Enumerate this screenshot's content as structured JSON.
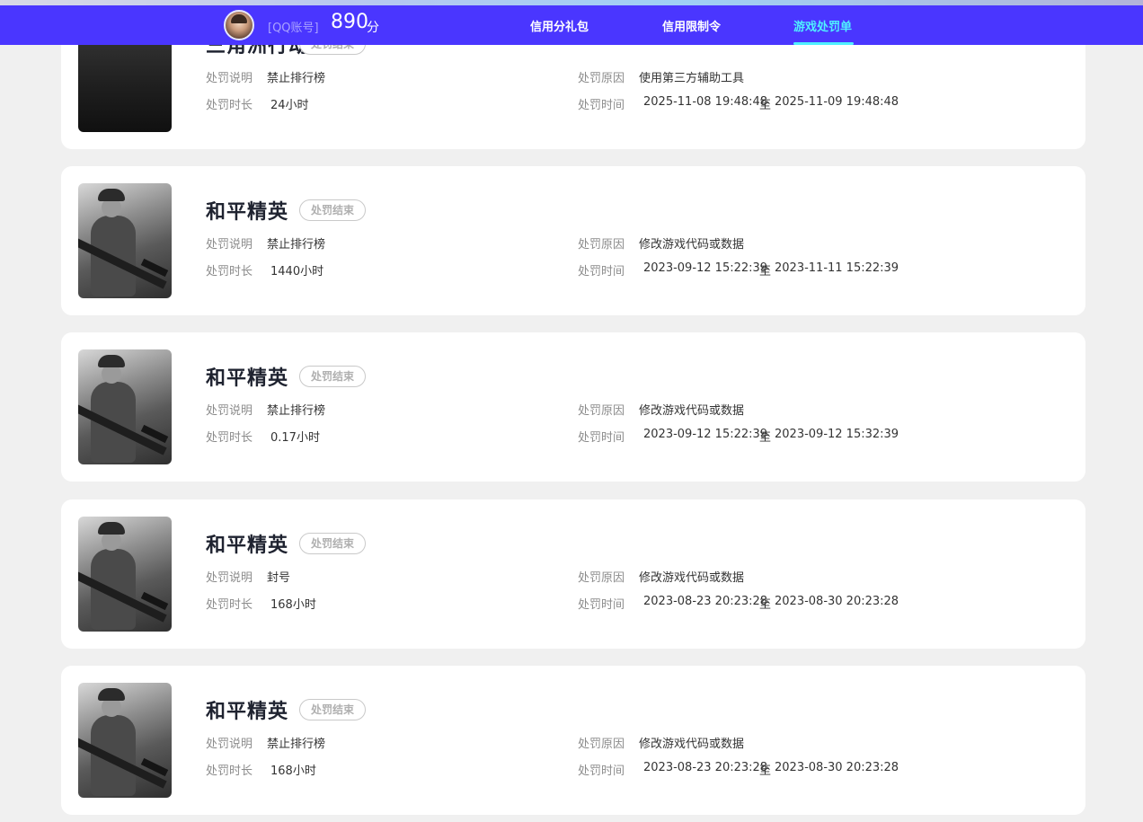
{
  "header": {
    "account_label": "[QQ账号]",
    "score": "890",
    "score_unit": "分",
    "tabs": [
      {
        "label": "信用分礼包"
      },
      {
        "label": "信用限制令"
      },
      {
        "label": "游戏处罚单"
      }
    ],
    "active_tab": "游戏处罚单"
  },
  "colors": {
    "nav_bg": "#4a36ff",
    "active_tab": "#4ff0ff",
    "page_bg": "#f0f0f0"
  },
  "labels": {
    "desc": "处罚说明",
    "reason": "处罚原因",
    "duration": "处罚时长",
    "time": "处罚时间",
    "to": "至"
  },
  "records": [
    {
      "game": "三角洲行动",
      "status": "处罚结束",
      "desc": "禁止排行榜",
      "reason": "使用第三方辅助工具",
      "duration": "24小时",
      "start": "2025-11-08 19:48:48",
      "end": "2025-11-09 19:48:48"
    },
    {
      "game": "和平精英",
      "status": "处罚结束",
      "desc": "禁止排行榜",
      "reason": "修改游戏代码或数据",
      "duration": "1440小时",
      "start": "2023-09-12 15:22:39",
      "end": "2023-11-11 15:22:39"
    },
    {
      "game": "和平精英",
      "status": "处罚结束",
      "desc": "禁止排行榜",
      "reason": "修改游戏代码或数据",
      "duration": "0.17小时",
      "start": "2023-09-12 15:22:39",
      "end": "2023-09-12 15:32:39"
    },
    {
      "game": "和平精英",
      "status": "处罚结束",
      "desc": "封号",
      "reason": "修改游戏代码或数据",
      "duration": "168小时",
      "start": "2023-08-23 20:23:28",
      "end": "2023-08-30 20:23:28"
    },
    {
      "game": "和平精英",
      "status": "处罚结束",
      "desc": "禁止排行榜",
      "reason": "修改游戏代码或数据",
      "duration": "168小时",
      "start": "2023-08-23 20:23:28",
      "end": "2023-08-30 20:23:28"
    }
  ]
}
